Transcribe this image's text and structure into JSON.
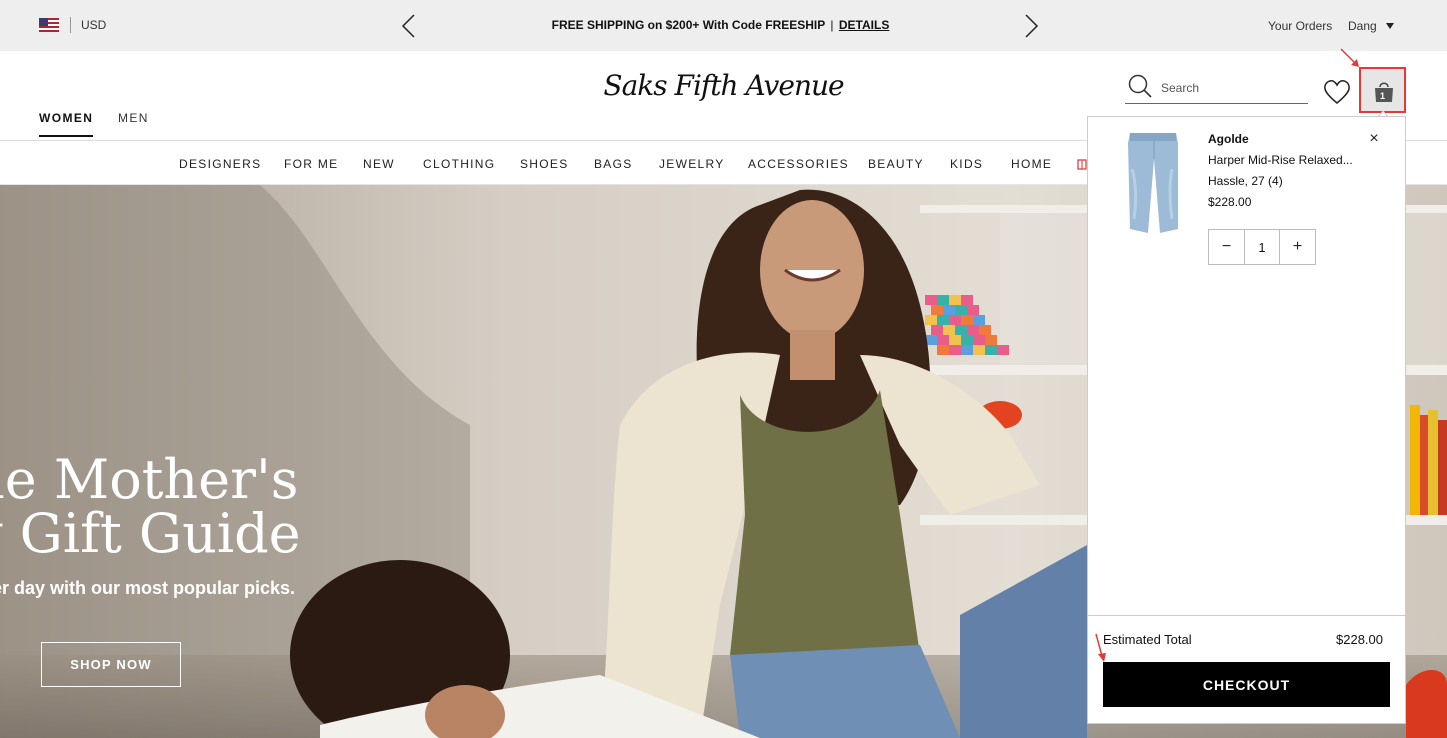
{
  "topbar": {
    "currency": "USD",
    "promo_text": "FREE SHIPPING on $200+ With Code FREESHIP",
    "promo_divider": "|",
    "promo_link": "DETAILS",
    "your_orders": "Your Orders",
    "user_name": "Dang"
  },
  "header": {
    "logo": "Saks Fifth Avenue",
    "gender_tabs": [
      "WOMEN",
      "MEN"
    ],
    "search_placeholder": "Search",
    "bag_count": "1"
  },
  "category_nav": [
    "DESIGNERS",
    "FOR ME",
    "NEW",
    "CLOTHING",
    "SHOES",
    "BAGS",
    "JEWELRY",
    "ACCESSORIES",
    "BEAUTY",
    "KIDS",
    "HOME"
  ],
  "hero": {
    "title_line1": "he Mother's",
    "title_line2": "y Gift Guide",
    "subtitle": "er day with our most popular picks.",
    "cta": "SHOP NOW"
  },
  "cart": {
    "item": {
      "brand": "Agolde",
      "name": "Harper Mid-Rise Relaxed...",
      "variant": "Hassle, 27 (4)",
      "price": "$228.00",
      "quantity": "1"
    },
    "close": "×",
    "minus": "−",
    "plus": "+",
    "estimated_total_label": "Estimated Total",
    "estimated_total_value": "$228.00",
    "checkout_label": "CHECKOUT"
  },
  "colors": {
    "topbar_bg": "#eeeeee",
    "annotation_red": "#e53935",
    "checkout_bg": "#000000"
  }
}
